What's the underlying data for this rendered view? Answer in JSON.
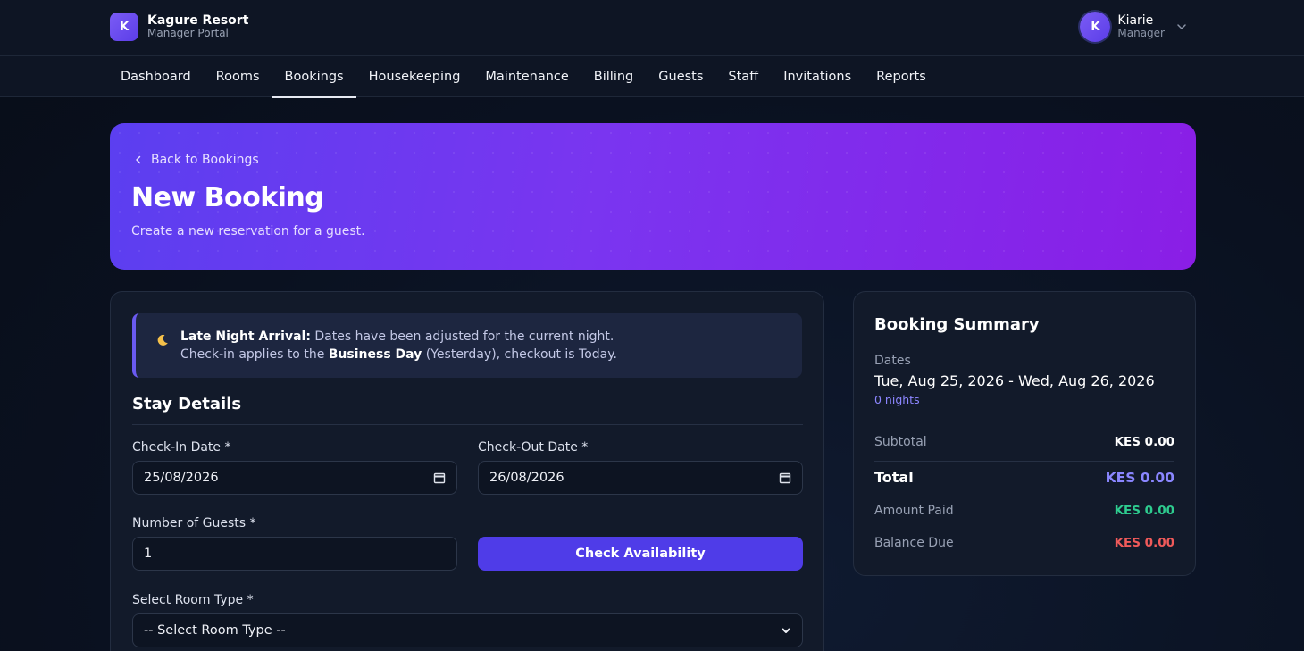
{
  "brand": {
    "logo_letter": "K",
    "name": "Kagure Resort",
    "subtitle": "Manager Portal"
  },
  "user": {
    "avatar_letter": "K",
    "name": "Kiarie",
    "role": "Manager"
  },
  "nav": {
    "items": [
      {
        "label": "Dashboard"
      },
      {
        "label": "Rooms"
      },
      {
        "label": "Bookings",
        "active": true
      },
      {
        "label": "Housekeeping"
      },
      {
        "label": "Maintenance"
      },
      {
        "label": "Billing"
      },
      {
        "label": "Guests"
      },
      {
        "label": "Staff"
      },
      {
        "label": "Invitations"
      },
      {
        "label": "Reports"
      }
    ]
  },
  "hero": {
    "back_label": "Back to Bookings",
    "title": "New Booking",
    "subtitle": "Create a new reservation for a guest."
  },
  "alert": {
    "icon": "moon-icon",
    "title": "Late Night Arrival:",
    "line1_rest": " Dates have been adjusted for the current night.",
    "line2_pre": "Check-in applies to the ",
    "line2_bold": "Business Day",
    "line2_post": " (Yesterday), checkout is Today."
  },
  "form": {
    "section_title": "Stay Details",
    "checkin_label": "Check-In Date *",
    "checkin_value": "25/08/2026",
    "checkout_label": "Check-Out Date *",
    "checkout_value": "26/08/2026",
    "guests_label": "Number of Guests *",
    "guests_value": "1",
    "check_button": "Check Availability",
    "room_type_label": "Select Room Type *",
    "room_type_value": "-- Select Room Type --"
  },
  "summary": {
    "title": "Booking Summary",
    "dates_label": "Dates",
    "dates_value": "Tue, Aug 25, 2026 - Wed, Aug 26, 2026",
    "nights": "0 nights",
    "subtotal_label": "Subtotal",
    "subtotal_value": "KES 0.00",
    "total_label": "Total",
    "total_value": "KES 0.00",
    "paid_label": "Amount Paid",
    "paid_value": "KES 0.00",
    "balance_label": "Balance Due",
    "balance_value": "KES 0.00"
  },
  "colors": {
    "accent": "#4f3ce8",
    "total": "#8a86ff",
    "paid": "#2ecc8f",
    "balance": "#f05a5a"
  }
}
